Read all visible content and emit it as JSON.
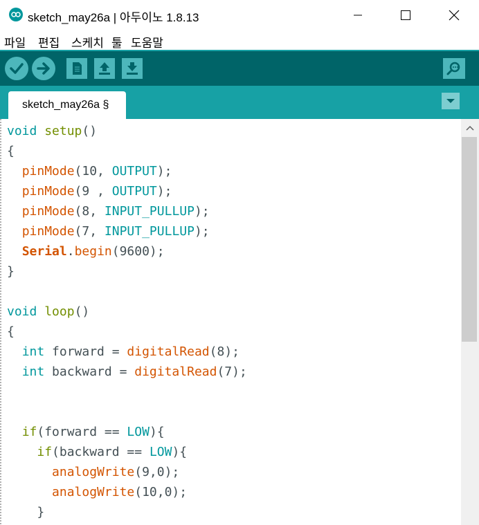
{
  "window": {
    "title": "sketch_may26a | 아두이노 1.8.13",
    "icon": "arduino-icon",
    "controls": [
      "minimize-icon",
      "maximize-icon",
      "close-icon"
    ]
  },
  "menu": [
    "파일",
    "편집",
    "스케치",
    "툴",
    "도움말"
  ],
  "toolbar": {
    "buttons": [
      "verify-icon",
      "upload-icon",
      "new-icon",
      "open-icon",
      "save-icon",
      "serial-monitor-icon"
    ]
  },
  "tabs": {
    "active": "sketch_may26a §",
    "menu_icon": "tab-menu-icon"
  },
  "code": {
    "lines": [
      [
        {
          "t": "void",
          "c": "type"
        },
        {
          "t": " ",
          "c": "plain"
        },
        {
          "t": "setup",
          "c": "kw"
        },
        {
          "t": "()",
          "c": "plain"
        }
      ],
      [
        {
          "t": "{",
          "c": "plain"
        }
      ],
      [
        {
          "t": "  ",
          "c": "plain"
        },
        {
          "t": "pinMode",
          "c": "fn"
        },
        {
          "t": "(10, ",
          "c": "plain"
        },
        {
          "t": "OUTPUT",
          "c": "const"
        },
        {
          "t": ");",
          "c": "plain"
        }
      ],
      [
        {
          "t": "  ",
          "c": "plain"
        },
        {
          "t": "pinMode",
          "c": "fn"
        },
        {
          "t": "(9 , ",
          "c": "plain"
        },
        {
          "t": "OUTPUT",
          "c": "const"
        },
        {
          "t": ");",
          "c": "plain"
        }
      ],
      [
        {
          "t": "  ",
          "c": "plain"
        },
        {
          "t": "pinMode",
          "c": "fn"
        },
        {
          "t": "(8, ",
          "c": "plain"
        },
        {
          "t": "INPUT_PULLUP",
          "c": "const"
        },
        {
          "t": ");",
          "c": "plain"
        }
      ],
      [
        {
          "t": "  ",
          "c": "plain"
        },
        {
          "t": "pinMode",
          "c": "fn"
        },
        {
          "t": "(7, ",
          "c": "plain"
        },
        {
          "t": "INPUT_PULLUP",
          "c": "const"
        },
        {
          "t": ");",
          "c": "plain"
        }
      ],
      [
        {
          "t": "  ",
          "c": "plain"
        },
        {
          "t": "Serial",
          "c": "obj"
        },
        {
          "t": ".",
          "c": "plain"
        },
        {
          "t": "begin",
          "c": "fn"
        },
        {
          "t": "(9600);",
          "c": "plain"
        }
      ],
      [
        {
          "t": "}",
          "c": "plain"
        }
      ],
      [],
      [
        {
          "t": "void",
          "c": "type"
        },
        {
          "t": " ",
          "c": "plain"
        },
        {
          "t": "loop",
          "c": "kw"
        },
        {
          "t": "()",
          "c": "plain"
        }
      ],
      [
        {
          "t": "{",
          "c": "plain"
        }
      ],
      [
        {
          "t": "  ",
          "c": "plain"
        },
        {
          "t": "int",
          "c": "type"
        },
        {
          "t": " forward = ",
          "c": "plain"
        },
        {
          "t": "digitalRead",
          "c": "fn"
        },
        {
          "t": "(8);",
          "c": "plain"
        }
      ],
      [
        {
          "t": "  ",
          "c": "plain"
        },
        {
          "t": "int",
          "c": "type"
        },
        {
          "t": " backward = ",
          "c": "plain"
        },
        {
          "t": "digitalRead",
          "c": "fn"
        },
        {
          "t": "(7);",
          "c": "plain"
        }
      ],
      [],
      [],
      [
        {
          "t": "  ",
          "c": "plain"
        },
        {
          "t": "if",
          "c": "kw"
        },
        {
          "t": "(forward == ",
          "c": "plain"
        },
        {
          "t": "LOW",
          "c": "const"
        },
        {
          "t": "){",
          "c": "plain"
        }
      ],
      [
        {
          "t": "    ",
          "c": "plain"
        },
        {
          "t": "if",
          "c": "kw"
        },
        {
          "t": "(backward == ",
          "c": "plain"
        },
        {
          "t": "LOW",
          "c": "const"
        },
        {
          "t": "){",
          "c": "plain"
        }
      ],
      [
        {
          "t": "      ",
          "c": "plain"
        },
        {
          "t": "analogWrite",
          "c": "fn"
        },
        {
          "t": "(9,0);",
          "c": "plain"
        }
      ],
      [
        {
          "t": "      ",
          "c": "plain"
        },
        {
          "t": "analogWrite",
          "c": "fn"
        },
        {
          "t": "(10,0);",
          "c": "plain"
        }
      ],
      [
        {
          "t": "    }",
          "c": "plain"
        }
      ]
    ]
  },
  "colors": {
    "toolbar_bg": "#006468",
    "tab_bg": "#17a1a5",
    "button_bg": "#4db7bb",
    "type_color": "#00979c",
    "keyword_color": "#728e00",
    "function_color": "#d35400",
    "text_color": "#434f54"
  }
}
